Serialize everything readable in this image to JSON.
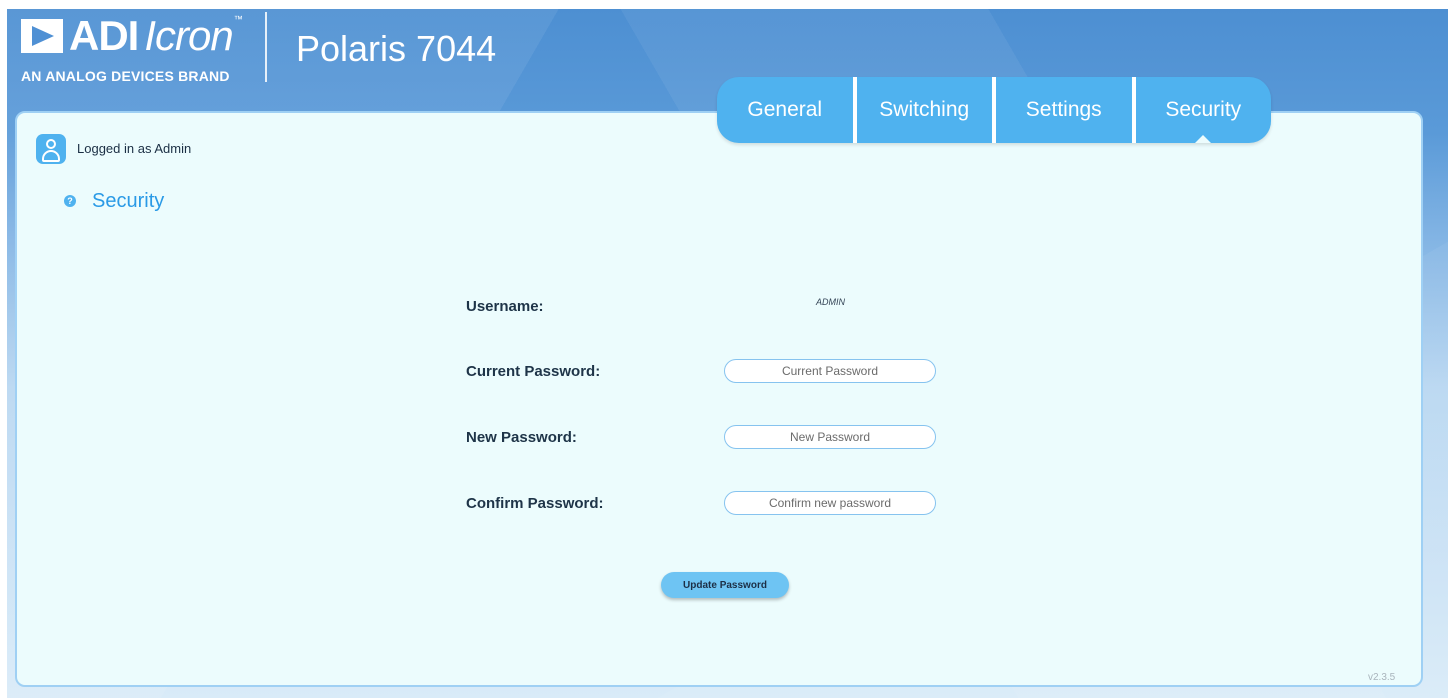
{
  "header": {
    "brand_word": "ADI",
    "brand_italic": "Icron",
    "brand_tm": "™",
    "brand_tagline": "AN ANALOG DEVICES BRAND",
    "product_name": "Polaris 7044"
  },
  "tabs": [
    {
      "label": "General",
      "active": false
    },
    {
      "label": "Switching",
      "active": false
    },
    {
      "label": "Settings",
      "active": false
    },
    {
      "label": "Security",
      "active": true
    }
  ],
  "user": {
    "status_text": "Logged in as Admin"
  },
  "section": {
    "help_glyph": "?",
    "title": "Security"
  },
  "form": {
    "username_label": "Username:",
    "username_value": "ADMIN",
    "current_password_label": "Current Password:",
    "current_password_placeholder": "Current Password",
    "new_password_label": "New Password:",
    "new_password_placeholder": "New Password",
    "confirm_password_label": "Confirm Password:",
    "confirm_password_placeholder": "Confirm new password",
    "update_button_label": "Update Password"
  },
  "footer": {
    "version": "v2.3.5"
  },
  "colors": {
    "accent": "#4fb2ef",
    "title_blue": "#2a9ae6",
    "panel_bg": "#ecfcfd",
    "header_blue": "#4d8fd2"
  },
  "icons": {
    "logo": "adi-triangle-logo-icon",
    "user": "user-avatar-icon",
    "help": "question-circle-icon"
  }
}
